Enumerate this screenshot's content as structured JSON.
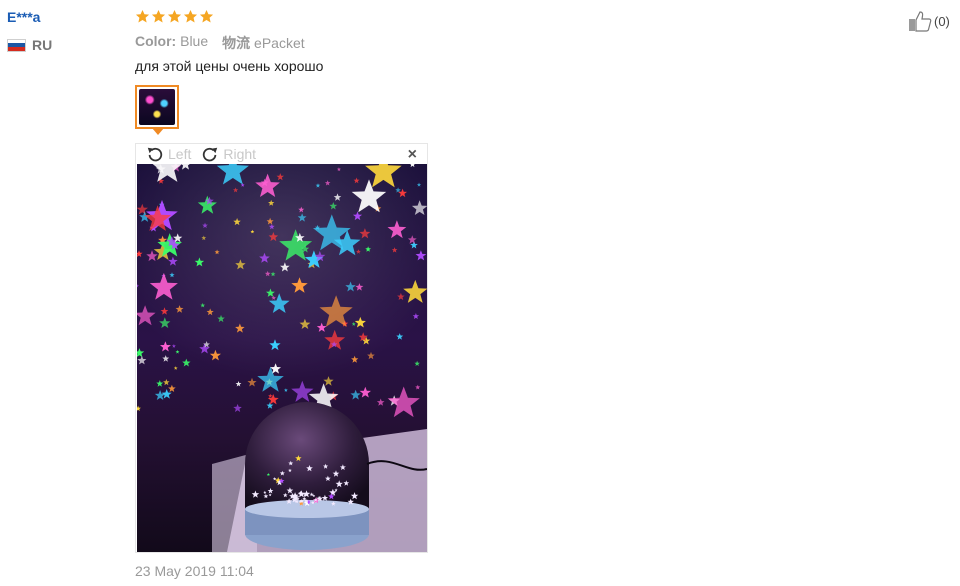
{
  "review": {
    "user_name": "E***a",
    "country_code": "RU",
    "rating": 5,
    "meta": {
      "color_key": "Color:",
      "color_value": "Blue",
      "logistics_key": "物流",
      "logistics_value": "ePacket"
    },
    "text": "для этой цены очень хорошо",
    "date": "23 May 2019 11:04",
    "like_count": "(0)"
  },
  "viewer": {
    "rotate_left_label": "Left",
    "rotate_right_label": "Right",
    "close_glyph": "×"
  },
  "colors": {
    "user_link": "#1a5cb4",
    "star": "#f5a623",
    "thumb_border": "#f08a24",
    "muted_text": "#999999"
  },
  "icons": {
    "rotate_left": "rotate-left-icon",
    "rotate_right": "rotate-right-icon",
    "close": "close-icon",
    "like": "thumbs-up-icon",
    "flag": "russia-flag-icon"
  }
}
